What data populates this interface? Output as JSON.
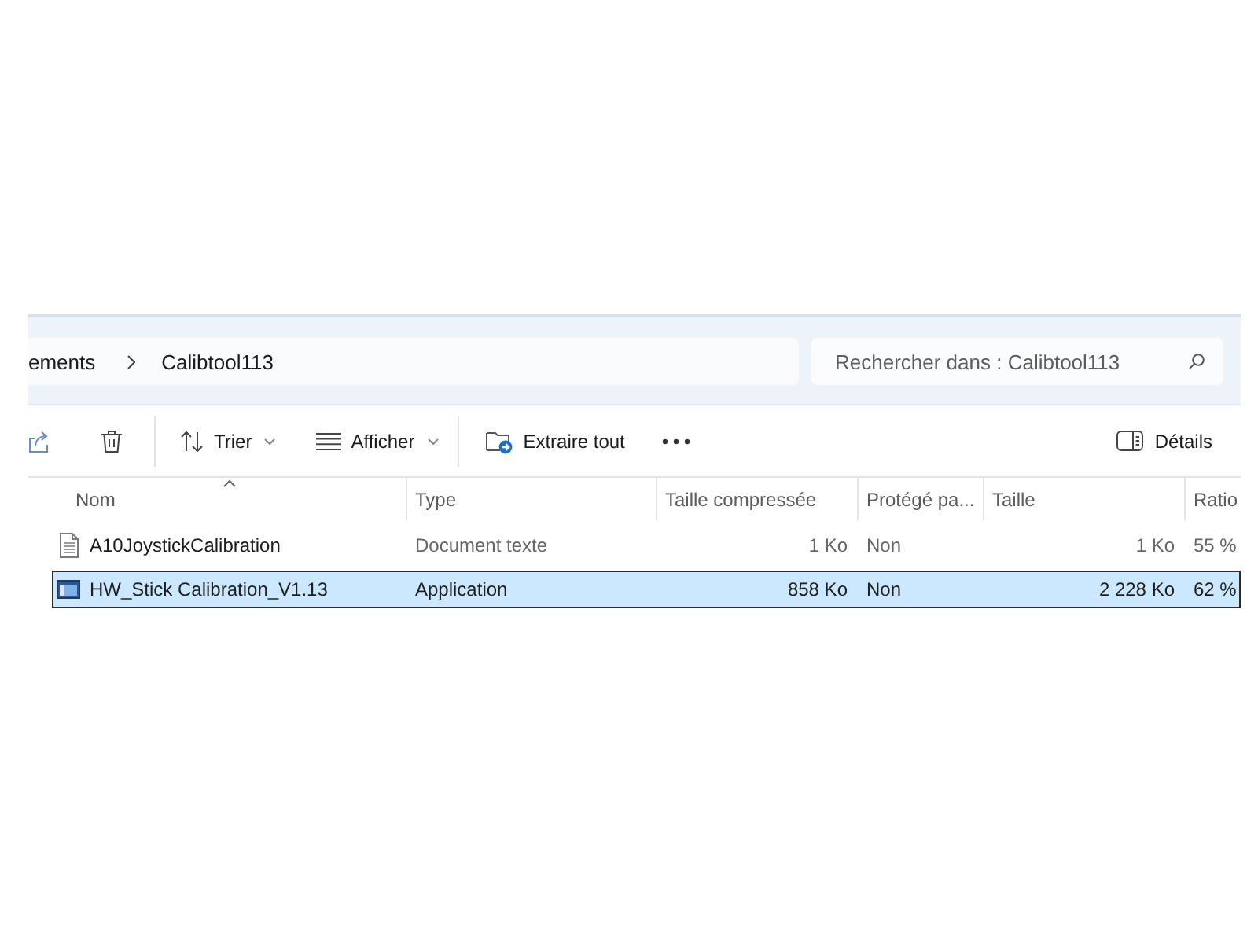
{
  "address_bar": {
    "breadcrumbs": [
      {
        "label": "ements"
      },
      {
        "label": "Calibtool113"
      }
    ]
  },
  "search": {
    "placeholder": "Rechercher dans : Calibtool113"
  },
  "toolbar": {
    "sort": {
      "label": "Trier"
    },
    "view": {
      "label": "Afficher"
    },
    "extract": {
      "label": "Extraire tout"
    },
    "details": {
      "label": "Détails"
    }
  },
  "table": {
    "columns": [
      {
        "label": "Nom",
        "sorted": true
      },
      {
        "label": "Type",
        "sorted": false
      },
      {
        "label": "Taille compressée",
        "sorted": false
      },
      {
        "label": "Protégé pa...",
        "sorted": false
      },
      {
        "label": "Taille",
        "sorted": false
      },
      {
        "label": "Ratio",
        "sorted": false
      }
    ],
    "rows": [
      {
        "kind": "text",
        "selected": false,
        "cells": [
          "A10JoystickCalibration",
          "Document texte",
          "1 Ko",
          "Non",
          "1 Ko",
          "55 %"
        ]
      },
      {
        "kind": "application",
        "selected": true,
        "cells": [
          "HW_Stick Calibration_V1.13",
          "Application",
          "858 Ko",
          "Non",
          "2 228 Ko",
          "62 %"
        ]
      }
    ]
  }
}
